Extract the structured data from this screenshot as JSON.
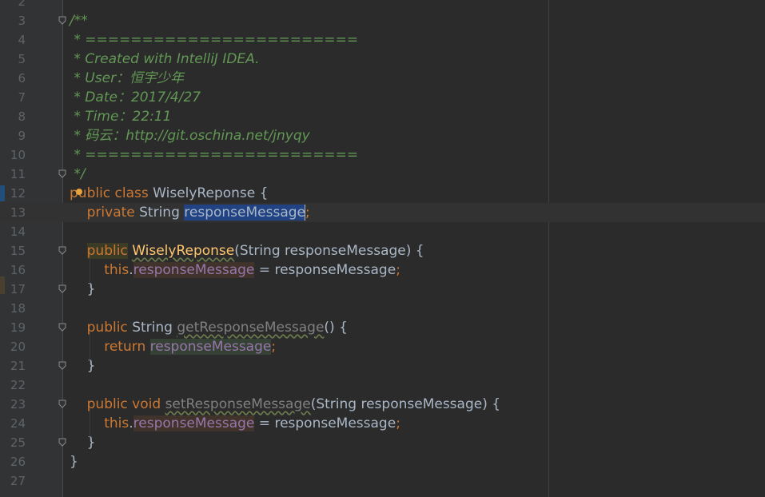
{
  "editor": {
    "lines": [
      {
        "n": "2",
        "segments": []
      },
      {
        "n": "3",
        "fold": true,
        "segments": [
          {
            "t": "/**",
            "c": "comment"
          }
        ]
      },
      {
        "n": "4",
        "segments": [
          {
            "t": " * ========================",
            "c": "comment"
          }
        ]
      },
      {
        "n": "5",
        "segments": [
          {
            "t": " * Created with IntelliJ IDEA.",
            "c": "comment"
          }
        ]
      },
      {
        "n": "6",
        "segments": [
          {
            "t": " * User：恒宇少年",
            "c": "comment"
          }
        ]
      },
      {
        "n": "7",
        "segments": [
          {
            "t": " * Date：2017/4/27",
            "c": "comment"
          }
        ]
      },
      {
        "n": "8",
        "segments": [
          {
            "t": " * Time：22:11",
            "c": "comment"
          }
        ]
      },
      {
        "n": "9",
        "segments": [
          {
            "t": " * 码云：http://git.oschina.net/jnyqy",
            "c": "comment"
          }
        ]
      },
      {
        "n": "10",
        "segments": [
          {
            "t": " * ========================",
            "c": "comment"
          }
        ]
      },
      {
        "n": "11",
        "fold": true,
        "segments": [
          {
            "t": " */",
            "c": "comment"
          }
        ]
      },
      {
        "n": "12",
        "bulb": true,
        "segments": [
          {
            "t": "public class ",
            "c": "kw"
          },
          {
            "t": "WiselyReponse {",
            "c": ""
          }
        ]
      },
      {
        "n": "13",
        "current": true,
        "segments": [
          {
            "t": "    ",
            "c": ""
          },
          {
            "t": "private ",
            "c": "kw"
          },
          {
            "t": "String ",
            "c": ""
          },
          {
            "t": "responseMessage",
            "c": "field sel"
          },
          {
            "t": "caret",
            "c": "caret"
          },
          {
            "t": ";",
            "c": "kw"
          }
        ]
      },
      {
        "n": "14",
        "segments": []
      },
      {
        "n": "15",
        "fold": true,
        "segments": [
          {
            "t": "    ",
            "c": ""
          },
          {
            "t": "public",
            "c": "kw kw-hl"
          },
          {
            "t": " ",
            "c": ""
          },
          {
            "t": "WiselyReponse",
            "c": "ctor wavy"
          },
          {
            "t": "(String responseMessage) {",
            "c": ""
          }
        ]
      },
      {
        "n": "16",
        "segments": [
          {
            "t": "        ",
            "c": ""
          },
          {
            "t": "this",
            "c": "kw"
          },
          {
            "t": ".",
            "c": ""
          },
          {
            "t": "responseMessage",
            "c": "field write-hl"
          },
          {
            "t": " = responseMessage",
            "c": ""
          },
          {
            "t": ";",
            "c": "kw"
          }
        ]
      },
      {
        "n": "17",
        "fold": true,
        "segments": [
          {
            "t": "    }",
            "c": ""
          }
        ]
      },
      {
        "n": "18",
        "segments": []
      },
      {
        "n": "19",
        "fold": true,
        "segments": [
          {
            "t": "    ",
            "c": ""
          },
          {
            "t": "public ",
            "c": "kw"
          },
          {
            "t": "String ",
            "c": ""
          },
          {
            "t": "getResponseMessage",
            "c": "unused wavy"
          },
          {
            "t": "() {",
            "c": ""
          }
        ]
      },
      {
        "n": "20",
        "segments": [
          {
            "t": "        ",
            "c": ""
          },
          {
            "t": "return ",
            "c": "kw"
          },
          {
            "t": "responseMessage",
            "c": "field ident-hl"
          },
          {
            "t": ";",
            "c": "kw"
          }
        ]
      },
      {
        "n": "21",
        "fold": true,
        "segments": [
          {
            "t": "    }",
            "c": ""
          }
        ]
      },
      {
        "n": "22",
        "segments": []
      },
      {
        "n": "23",
        "fold": true,
        "segments": [
          {
            "t": "    ",
            "c": ""
          },
          {
            "t": "public void ",
            "c": "kw"
          },
          {
            "t": "setResponseMessage",
            "c": "unused wavy"
          },
          {
            "t": "(String responseMessage) {",
            "c": ""
          }
        ]
      },
      {
        "n": "24",
        "segments": [
          {
            "t": "        ",
            "c": ""
          },
          {
            "t": "this",
            "c": "kw"
          },
          {
            "t": ".",
            "c": ""
          },
          {
            "t": "responseMessage",
            "c": "field write-hl"
          },
          {
            "t": " = responseMessage",
            "c": ""
          },
          {
            "t": ";",
            "c": "kw"
          }
        ]
      },
      {
        "n": "25",
        "fold": true,
        "segments": [
          {
            "t": "    }",
            "c": ""
          }
        ]
      },
      {
        "n": "26",
        "segments": [
          {
            "t": "}",
            "c": ""
          }
        ]
      },
      {
        "n": "27",
        "segments": []
      }
    ]
  },
  "colors": {
    "background": "#2b2b2b",
    "gutter": "#313335",
    "keyword": "#cc7832",
    "comment": "#629755",
    "field": "#9876aa",
    "selection": "#214283"
  }
}
